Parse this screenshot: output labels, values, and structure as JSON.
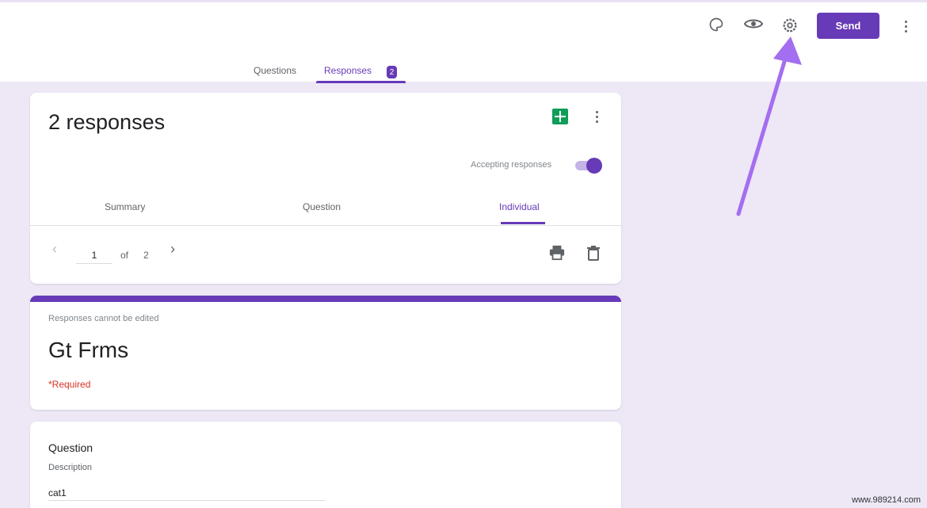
{
  "header": {
    "send_label": "Send",
    "icons": [
      "palette-icon",
      "eye-icon",
      "settings-icon",
      "more-vert-icon"
    ]
  },
  "top_tabs": {
    "questions": "Questions",
    "responses": "Responses",
    "responses_badge": "2"
  },
  "summary_card": {
    "count_text": "2 responses",
    "accepting_label": "Accepting responses",
    "accepting_on": true,
    "tabs": {
      "summary": "Summary",
      "question": "Question",
      "individual": "Individual"
    },
    "pager": {
      "current": "1",
      "of_label": "of",
      "total": "2"
    }
  },
  "form_card": {
    "notice": "Responses cannot be edited",
    "title": "Gt Frms",
    "required": "*Required"
  },
  "question_card": {
    "title": "Question",
    "description": "Description",
    "answer": "cat1"
  },
  "watermark": "www.989214.com",
  "colors": {
    "accent": "#673ab7",
    "background": "#ede7f6",
    "sheets": "#0f9d58",
    "required": "#d93025",
    "arrow": "#a46ef0"
  }
}
